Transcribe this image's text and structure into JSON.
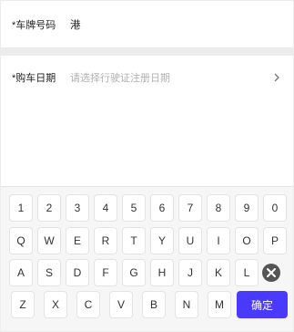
{
  "form": {
    "plate": {
      "label": "*车牌号码",
      "value": "港"
    },
    "date": {
      "label": "*购车日期",
      "placeholder": "请选择行驶证注册日期"
    }
  },
  "keyboard": {
    "row1": [
      "1",
      "2",
      "3",
      "4",
      "5",
      "6",
      "7",
      "8",
      "9",
      "0"
    ],
    "row2": [
      "Q",
      "W",
      "E",
      "R",
      "T",
      "Y",
      "U",
      "I",
      "O",
      "P"
    ],
    "row3": [
      "A",
      "S",
      "D",
      "F",
      "G",
      "H",
      "J",
      "K",
      "L"
    ],
    "row4": [
      "Z",
      "X",
      "C",
      "V",
      "B",
      "N",
      "M"
    ],
    "confirm_label": "确定",
    "delete_icon": "delete-circle-icon"
  },
  "colors": {
    "accent": "#4a3aff",
    "placeholder": "#b0b0b0",
    "divider": "#ececec",
    "keyboard_bg": "#f6f6f6"
  }
}
